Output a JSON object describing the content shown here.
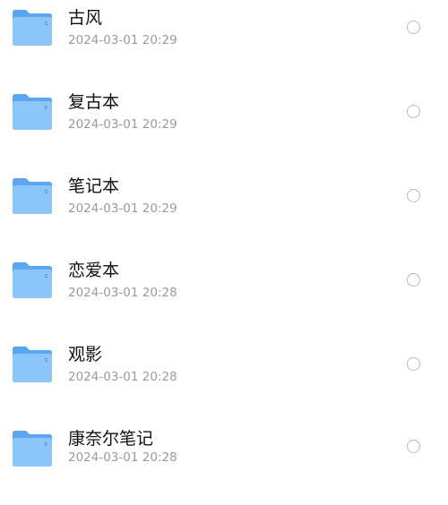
{
  "folders": [
    {
      "name": "古风",
      "modified": "2024-03-01 20:29"
    },
    {
      "name": "复古本",
      "modified": "2024-03-01 20:29"
    },
    {
      "name": "笔记本",
      "modified": "2024-03-01 20:29"
    },
    {
      "name": "恋爱本",
      "modified": "2024-03-01 20:28"
    },
    {
      "name": "观影",
      "modified": "2024-03-01 20:28"
    },
    {
      "name": "康奈尔笔记",
      "modified": "2024-03-01 20:28"
    }
  ],
  "icons": {
    "folder": "folder-icon",
    "select": "radio-circle-icon"
  },
  "colors": {
    "folder_back": "#5aa6f0",
    "folder_front": "#8cc6f8",
    "name_text": "#111111",
    "meta_text": "#9a9a9a",
    "radio_border": "#b8b8b8"
  }
}
